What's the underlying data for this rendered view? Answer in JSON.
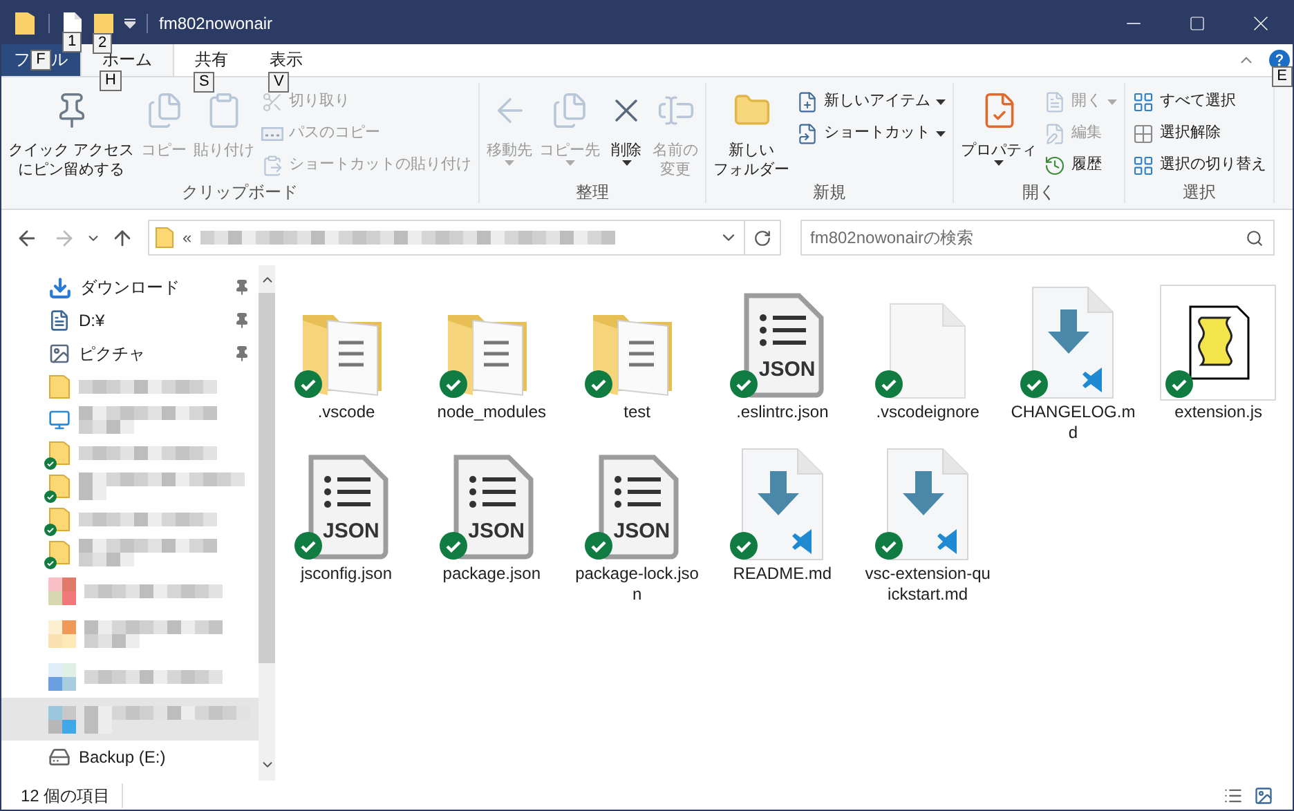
{
  "window": {
    "title": "fm802nowonair",
    "quick_access_keytips": [
      "1",
      "2"
    ]
  },
  "ribbon_tabs": [
    {
      "kind": "file",
      "label_start": "フ",
      "keytip": "F",
      "label_end": "ル",
      "selected": false
    },
    {
      "kind": "tab",
      "label": "ホーム",
      "keytip": "H",
      "selected": true
    },
    {
      "kind": "tab",
      "label": "共有",
      "keytip": "S",
      "selected": false
    },
    {
      "kind": "tab",
      "label": "表示",
      "keytip": "V",
      "selected": false
    }
  ],
  "help_keytip": "E",
  "ribbon_groups": [
    {
      "label": "クリップボード",
      "columns": [
        {
          "kind": "large",
          "lines": [
            "クイック アクセス",
            "にピン留めする"
          ],
          "disabled": false,
          "dropdown": false
        },
        {
          "kind": "large",
          "lines": [
            "コピー"
          ],
          "disabled": true,
          "dropdown": false
        },
        {
          "kind": "large",
          "lines": [
            "貼り付け"
          ],
          "disabled": true,
          "dropdown": false
        },
        {
          "kind": "stack",
          "items": [
            {
              "label": "切り取り",
              "disabled": true,
              "dropdown": false
            },
            {
              "label": "パスのコピー",
              "disabled": true,
              "dropdown": false
            },
            {
              "label": "ショートカットの貼り付け",
              "disabled": true,
              "dropdown": false
            }
          ]
        }
      ]
    },
    {
      "label": "整理",
      "columns": [
        {
          "kind": "large",
          "lines": [
            "移動先"
          ],
          "disabled": true,
          "dropdown": true
        },
        {
          "kind": "large",
          "lines": [
            "コピー先"
          ],
          "disabled": true,
          "dropdown": true
        },
        {
          "kind": "large",
          "lines": [
            "削除"
          ],
          "disabled": false,
          "dropdown": true
        },
        {
          "kind": "large",
          "lines": [
            "名前の",
            "変更"
          ],
          "disabled": true,
          "dropdown": false
        }
      ]
    },
    {
      "label": "新規",
      "columns": [
        {
          "kind": "large",
          "lines": [
            "新しい",
            "フォルダー"
          ],
          "disabled": false,
          "dropdown": false
        },
        {
          "kind": "stack",
          "items": [
            {
              "label": "新しいアイテム",
              "disabled": false,
              "dropdown": true
            },
            {
              "label": "ショートカット",
              "disabled": false,
              "dropdown": true
            }
          ]
        }
      ]
    },
    {
      "label": "開く",
      "columns": [
        {
          "kind": "large",
          "lines": [
            "プロパティ"
          ],
          "disabled": false,
          "dropdown": true
        },
        {
          "kind": "stack",
          "items": [
            {
              "label": "開く",
              "disabled": true,
              "dropdown": true
            },
            {
              "label": "編集",
              "disabled": true,
              "dropdown": false
            },
            {
              "label": "履歴",
              "disabled": false,
              "dropdown": false
            }
          ]
        }
      ]
    },
    {
      "label": "選択",
      "columns": [
        {
          "kind": "stack",
          "items": [
            {
              "label": "すべて選択",
              "disabled": false,
              "dropdown": false
            },
            {
              "label": "選択解除",
              "disabled": false,
              "dropdown": false
            },
            {
              "label": "選択の切り替え",
              "disabled": false,
              "dropdown": false
            }
          ]
        }
      ]
    }
  ],
  "address_bar": {
    "path_prefix": "«"
  },
  "search": {
    "placeholder": "fm802nowonairの検索"
  },
  "nav_items": [
    {
      "label": "ダウンロード",
      "pinned": true,
      "synced": false,
      "selected": false
    },
    {
      "label": "D:¥",
      "pinned": true,
      "synced": false,
      "selected": false
    },
    {
      "label": "ピクチャ",
      "pinned": true,
      "synced": false,
      "selected": false
    },
    {
      "pinned": false,
      "synced": false,
      "selected": false
    },
    {
      "pinned": false,
      "synced": false,
      "selected": false
    },
    {
      "pinned": false,
      "synced": true,
      "selected": false
    },
    {
      "pinned": false,
      "synced": true,
      "selected": false
    },
    {
      "pinned": false,
      "synced": true,
      "selected": false
    },
    {
      "pinned": false,
      "synced": true,
      "selected": false
    },
    {
      "pinned": false,
      "synced": false,
      "selected": false
    },
    {
      "pinned": false,
      "synced": false,
      "selected": false
    },
    {
      "pinned": false,
      "synced": false,
      "selected": false
    },
    {
      "pinned": false,
      "synced": false,
      "selected": true
    },
    {
      "label": "Backup (E:)",
      "pinned": false,
      "synced": false,
      "selected": false
    }
  ],
  "files": [
    {
      "name": ".vscode",
      "kind": "folder",
      "synced": true
    },
    {
      "name": "node_modules",
      "kind": "folder",
      "synced": true
    },
    {
      "name": "test",
      "kind": "folder",
      "synced": true
    },
    {
      "name": ".eslintrc.json",
      "kind": "json",
      "badge": "JSON",
      "synced": true
    },
    {
      "name": ".vscodeignore",
      "kind": "blank",
      "synced": true
    },
    {
      "name": "CHANGELOG.md",
      "kind": "markdown",
      "synced": true
    },
    {
      "name": "extension.js",
      "kind": "script",
      "synced": true
    },
    {
      "name": "jsconfig.json",
      "kind": "json",
      "badge": "JSON",
      "synced": true
    },
    {
      "name": "package.json",
      "kind": "json",
      "badge": "JSON",
      "synced": true
    },
    {
      "name": "package-lock.json",
      "kind": "json",
      "badge": "JSON",
      "synced": true
    },
    {
      "name": "README.md",
      "kind": "markdown",
      "synced": true
    },
    {
      "name": "vsc-extension-quickstart.md",
      "kind": "markdown",
      "synced": true
    }
  ],
  "status_bar": {
    "item_count": "12 個の項目"
  }
}
